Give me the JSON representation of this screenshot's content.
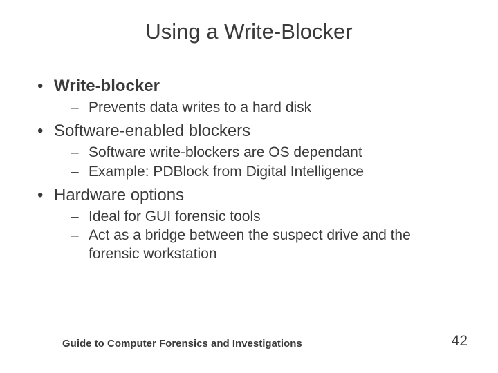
{
  "title": "Using a Write-Blocker",
  "bullets": [
    {
      "text": "Write-blocker",
      "bold": true,
      "sub": [
        "Prevents data writes to a hard disk"
      ]
    },
    {
      "text": "Software-enabled blockers",
      "bold": false,
      "sub": [
        "Software write-blockers are OS dependant",
        "Example: PDBlock from Digital Intelligence"
      ]
    },
    {
      "text": "Hardware options",
      "bold": false,
      "sub": [
        "Ideal for GUI forensic tools",
        "Act as a bridge between the suspect drive and the forensic workstation"
      ]
    }
  ],
  "footer": {
    "left": "Guide to Computer Forensics and Investigations",
    "right": "42"
  }
}
